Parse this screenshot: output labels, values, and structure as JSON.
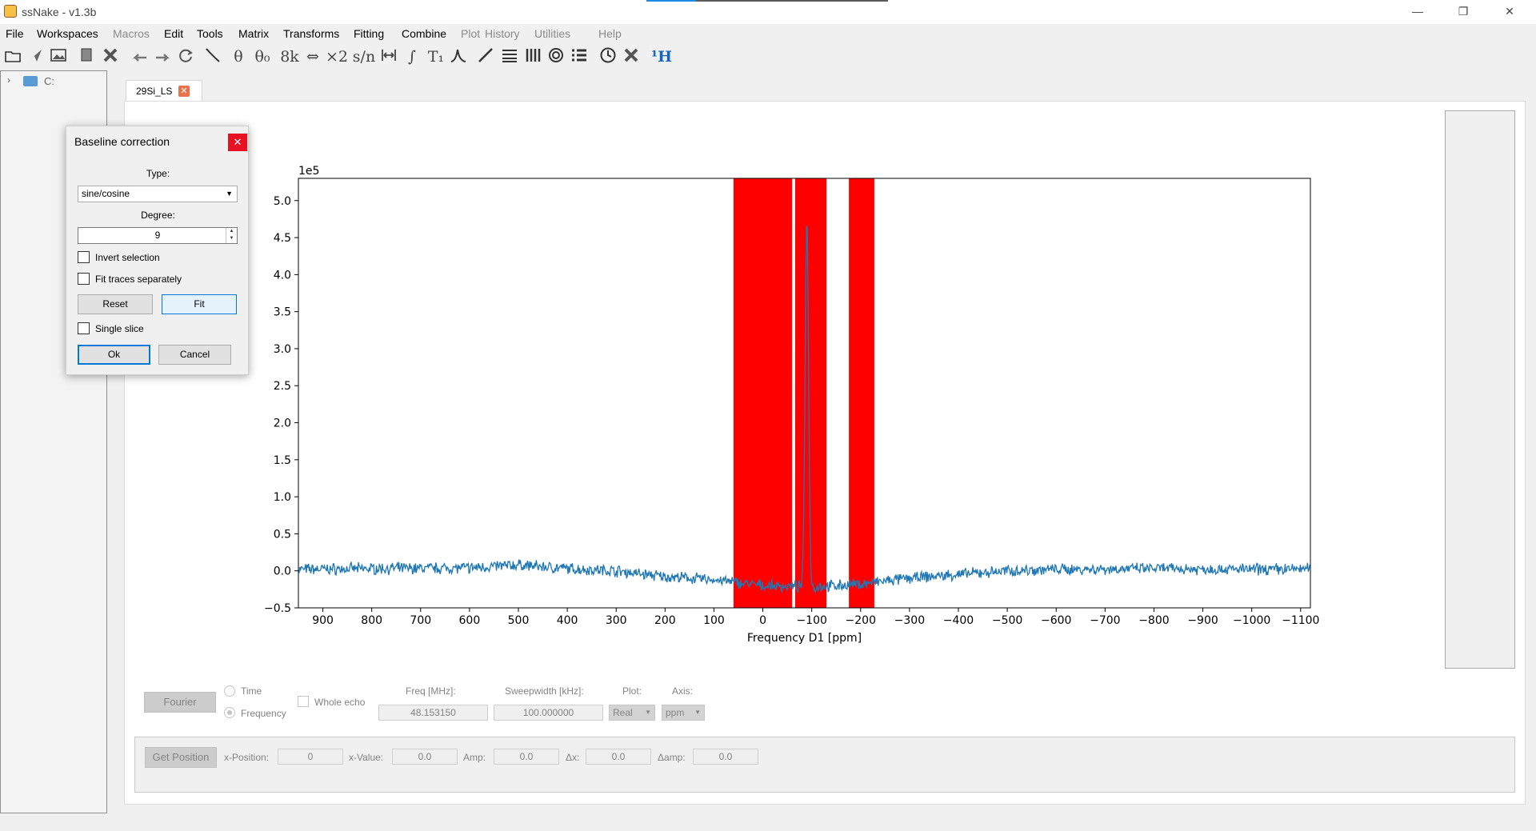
{
  "window": {
    "title": "ssNake - v1.3b"
  },
  "menu": [
    "File",
    "Workspaces",
    "Macros",
    "Edit",
    "Tools",
    "Matrix",
    "Transforms",
    "Fitting",
    "Combine",
    "Plot",
    "History",
    "Utilities",
    "Help"
  ],
  "menu_disabled": [
    "Macros",
    "Plot",
    "History",
    "Utilities",
    "Help"
  ],
  "toolbar": {
    "icons": [
      "open-folder-icon",
      "export-icon",
      "image-icon",
      "copy-icon",
      "close-workspace-icon",
      "undo-icon",
      "redo-icon",
      "reload-icon",
      "line-icon",
      "theta-icon",
      "theta0-icon",
      "size-8k-icon",
      "shift-icon",
      "multiply-2-icon",
      "sn-icon",
      "fwhm-icon",
      "integrate-icon",
      "t1-icon",
      "peak-icon",
      "diagonal-icon",
      "lines-icon",
      "columns-icon",
      "circle-icon",
      "list-icon",
      "clock-icon",
      "cross-icon",
      "nucleus-1h-icon"
    ],
    "labels": {
      "theta": "θ",
      "theta0": "θ₀",
      "size": "8k",
      "shift": "⇔",
      "mult": "×2",
      "sn": "s/n",
      "integrate": "∫",
      "t1": "T₁",
      "h1": "¹H"
    }
  },
  "sidebar": {
    "drive_label": "C:"
  },
  "tab": {
    "label": "29Si_LS"
  },
  "chart_data": {
    "type": "line",
    "scale_label": "1e5",
    "xlabel": "Frequency D1 [ppm]",
    "ylabel": "",
    "xlim": [
      950,
      -1120
    ],
    "ylim": [
      -0.5,
      5.3
    ],
    "x_ticks": [
      900,
      800,
      700,
      600,
      500,
      400,
      300,
      200,
      100,
      0,
      -100,
      -200,
      -300,
      -400,
      -500,
      -600,
      -700,
      -800,
      -900,
      -1000,
      -1100
    ],
    "x_tick_labels": [
      "900",
      "800",
      "700",
      "600",
      "500",
      "400",
      "300",
      "200",
      "100",
      "0",
      "−100",
      "−200",
      "−300",
      "−400",
      "−500",
      "−600",
      "−700",
      "−800",
      "−900",
      "−1000",
      "−1100"
    ],
    "y_ticks": [
      -0.5,
      0.0,
      0.5,
      1.0,
      1.5,
      2.0,
      2.5,
      3.0,
      3.5,
      4.0,
      4.5,
      5.0
    ],
    "y_tick_labels": [
      "−0.5",
      "0.0",
      "0.5",
      "1.0",
      "1.5",
      "2.0",
      "2.5",
      "3.0",
      "3.5",
      "4.0",
      "4.5",
      "5.0"
    ],
    "series_color": "#1f77b4",
    "excluded_regions_color": "#ff0000",
    "excluded_regions": [
      [
        -60,
        60
      ],
      [
        -130,
        -66
      ],
      [
        -228,
        -176
      ]
    ],
    "peak": {
      "x": -90,
      "y": 5.0,
      "width": 5
    },
    "baseline": [
      {
        "x": 950,
        "y": 0.02
      },
      {
        "x": 800,
        "y": 0.03
      },
      {
        "x": 600,
        "y": 0.04
      },
      {
        "x": 500,
        "y": 0.08
      },
      {
        "x": 400,
        "y": 0.03
      },
      {
        "x": 300,
        "y": 0.0
      },
      {
        "x": 200,
        "y": -0.08
      },
      {
        "x": 100,
        "y": -0.12
      },
      {
        "x": 0,
        "y": -0.2
      },
      {
        "x": -100,
        "y": -0.22
      },
      {
        "x": -200,
        "y": -0.18
      },
      {
        "x": -300,
        "y": -0.1
      },
      {
        "x": -400,
        "y": -0.05
      },
      {
        "x": -500,
        "y": 0.0
      },
      {
        "x": -600,
        "y": 0.02
      },
      {
        "x": -800,
        "y": 0.03
      },
      {
        "x": -1000,
        "y": 0.02
      },
      {
        "x": -1120,
        "y": 0.03
      }
    ],
    "noise_amplitude": 0.06
  },
  "controls": {
    "fourier_label": "Fourier",
    "time_label": "Time",
    "frequency_label": "Frequency",
    "domain_selected": "Frequency",
    "whole_echo_label": "Whole echo",
    "freq_label": "Freq [MHz]:",
    "freq_value": "48.153150",
    "sweepwidth_label": "Sweepwidth [kHz]:",
    "sweepwidth_value": "100.000000",
    "plot_label": "Plot:",
    "plot_value": "Real",
    "axis_label": "Axis:",
    "axis_value": "ppm"
  },
  "position": {
    "get_position_label": "Get Position",
    "xpos_label": "x-Position:",
    "xpos_value": "0",
    "xvalue_label": "x-Value:",
    "xvalue_value": "0.0",
    "amp_label": "Amp:",
    "amp_value": "0.0",
    "dx_label": "Δx:",
    "dx_value": "0.0",
    "damp_label": "Δamp:",
    "damp_value": "0.0"
  },
  "dialog": {
    "title": "Baseline correction",
    "type_label": "Type:",
    "type_value": "sine/cosine",
    "degree_label": "Degree:",
    "degree_value": "9",
    "invert_selection_label": "Invert selection",
    "invert_selection_checked": false,
    "fit_traces_label": "Fit traces separately",
    "fit_traces_checked": false,
    "reset_label": "Reset",
    "fit_label": "Fit",
    "single_slice_label": "Single slice",
    "single_slice_checked": false,
    "ok_label": "Ok",
    "cancel_label": "Cancel"
  }
}
